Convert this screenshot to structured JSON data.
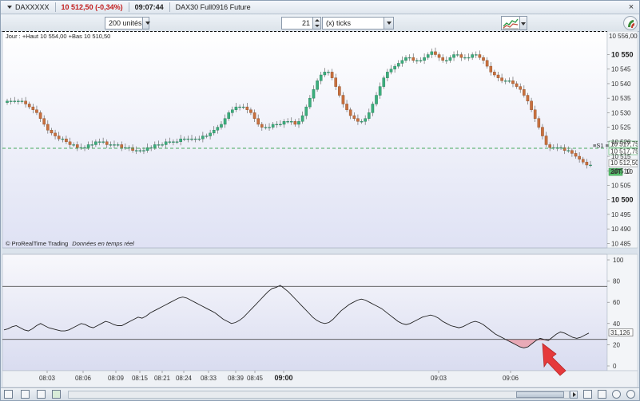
{
  "title_bar": {
    "instrument": "DAXXXXX",
    "price_change": "10 512,50 (-0,34%)",
    "time": "09:07:44",
    "description": "DAX30 Full0916 Future",
    "close_glyph": "×"
  },
  "toolbar": {
    "units_value": "200 unités",
    "ticks_value": "21",
    "ticks_unit": "(x) ticks"
  },
  "price_panel": {
    "info_text": "Jour : +Haut 10 554,00 +Bas 10 510,50",
    "watermark_brand": "© ProRealTime Trading",
    "watermark_feed": "Données en temps réel",
    "top_value_label": "10 556,00",
    "ytick_labels": [
      "10 550",
      "10 545",
      "10 540",
      "10 535",
      "10 530",
      "10 525",
      "10 520",
      "10 515",
      "10 510",
      "10 505",
      "10 500",
      "10 495",
      "10 490",
      "10 485"
    ],
    "ytick_bold": [
      "10 550",
      "10 500"
    ],
    "dashed_level_label": "10 517,75",
    "dashed_level_tag": "≡S1 ≡",
    "dashed_level_label_2": "10 517,75",
    "last_price_label": "10 512,50",
    "timer_tag": "20T",
    "timer_value": "10"
  },
  "indicator_panel": {
    "ytick_labels": [
      "100",
      "80",
      "60",
      "40",
      "20",
      "0"
    ],
    "upper_level": 75,
    "lower_level": 25,
    "current_value_label": "31,126"
  },
  "time_axis": {
    "labels": [
      "08:03",
      "08:06",
      "08:09",
      "08:15",
      "08:21",
      "08:24",
      "08:33",
      "08:39",
      "08:45",
      "09:00",
      "09:03",
      "09:06"
    ],
    "bold_label": "09:00"
  },
  "colors": {
    "bull_candle": "#3cae7d",
    "bear_candle": "#c8703e",
    "dashed_level": "#45a85d",
    "oversold_fill": "#e9a0ab",
    "annotation_arrow": "#e5393b",
    "last_price_tag": "#58c26e"
  },
  "chart_data": [
    {
      "type": "candlestick",
      "title": "",
      "ylim": [
        10484,
        10557
      ],
      "price_candles_close": [
        10534,
        10534,
        10534,
        10534,
        10534,
        10533,
        10532,
        10531,
        10530,
        10528,
        10526,
        10524,
        10523,
        10522,
        10521,
        10521,
        10520,
        10519,
        10519,
        10518,
        10518,
        10518,
        10519,
        10519,
        10520,
        10520,
        10520,
        10519,
        10519,
        10519,
        10519,
        10518,
        10518,
        10518,
        10517,
        10517,
        10517,
        10517,
        10518,
        10518,
        10519,
        10519,
        10519,
        10520,
        10520,
        10520,
        10520,
        10521,
        10521,
        10521,
        10521,
        10521,
        10521,
        10522,
        10522,
        10523,
        10524,
        10525,
        10526,
        10528,
        10530,
        10531,
        10532,
        10532,
        10532,
        10531,
        10530,
        10528,
        10526,
        10525,
        10525,
        10525,
        10526,
        10526,
        10526,
        10527,
        10527,
        10527,
        10526,
        10527,
        10529,
        10532,
        10535,
        10538,
        10541,
        10543,
        10544,
        10544,
        10542,
        10539,
        10536,
        10533,
        10531,
        10529,
        10528,
        10527,
        10527,
        10528,
        10530,
        10533,
        10536,
        10539,
        10542,
        10544,
        10545,
        10546,
        10547,
        10548,
        10549,
        10549,
        10548,
        10548,
        10548,
        10549,
        10550,
        10551,
        10550,
        10549,
        10548,
        10548,
        10549,
        10550,
        10550,
        10549,
        10549,
        10549,
        10550,
        10550,
        10549,
        10548,
        10546,
        10544,
        10543,
        10542,
        10541,
        10541,
        10541,
        10540,
        10539,
        10538,
        10536,
        10534,
        10531,
        10528,
        10525,
        10522,
        10519,
        10518,
        10518,
        10518,
        10518,
        10517,
        10517,
        10516,
        10515,
        10514,
        10513,
        10512,
        10512
      ],
      "dashed_level": 10517.75,
      "last_price": 10512.5,
      "day_high": 10554.0,
      "day_low": 10510.5
    },
    {
      "type": "line",
      "title": "",
      "ylim": [
        0,
        100
      ],
      "upper_level": 75,
      "lower_level": 25,
      "values": [
        34,
        35,
        37,
        38,
        36,
        34,
        33,
        35,
        38,
        40,
        38,
        36,
        35,
        34,
        33,
        33,
        34,
        36,
        38,
        40,
        39,
        37,
        36,
        38,
        40,
        42,
        41,
        39,
        38,
        38,
        40,
        42,
        44,
        46,
        45,
        47,
        50,
        52,
        54,
        56,
        58,
        60,
        62,
        64,
        65,
        64,
        62,
        60,
        58,
        56,
        54,
        52,
        50,
        47,
        44,
        42,
        40,
        41,
        43,
        46,
        50,
        54,
        58,
        62,
        66,
        70,
        73,
        74,
        76,
        73,
        70,
        66,
        62,
        58,
        54,
        50,
        46,
        43,
        41,
        40,
        41,
        44,
        48,
        52,
        55,
        58,
        60,
        62,
        63,
        62,
        60,
        58,
        56,
        54,
        51,
        48,
        45,
        42,
        40,
        39,
        40,
        42,
        44,
        46,
        47,
        48,
        47,
        45,
        42,
        40,
        38,
        37,
        36,
        37,
        39,
        41,
        42,
        41,
        39,
        36,
        33,
        30,
        28,
        26,
        24,
        22,
        20,
        18,
        17,
        18,
        21,
        24,
        26,
        25,
        24,
        27,
        30,
        32,
        31,
        29,
        27,
        26,
        27,
        29,
        31
      ],
      "last_value": 31.126
    }
  ]
}
